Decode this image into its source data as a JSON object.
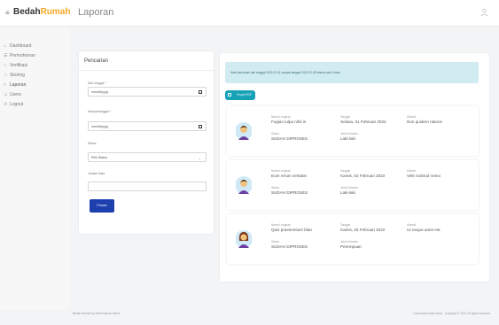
{
  "header": {
    "brand_prefix": "Bedah",
    "brand_accent": "Rumah",
    "page_title": "Laporan",
    "accent_color": "#f5a623"
  },
  "sidebar": {
    "items": [
      {
        "label": "Dashboard",
        "icon": "home-icon"
      },
      {
        "label": "Permohonan",
        "icon": "file-icon"
      },
      {
        "label": "Verifikasi",
        "icon": "check-icon"
      },
      {
        "label": "Skoring",
        "icon": "star-icon"
      },
      {
        "label": "Laporan",
        "icon": "report-icon"
      },
      {
        "label": "Users",
        "icon": "users-icon"
      },
      {
        "label": "Logout",
        "icon": "logout-icon"
      }
    ]
  },
  "search": {
    "title": "Pencarian",
    "from_label": "Dari tanggal *",
    "from_value": "mm/dd/yyyy",
    "to_label": "Sampai tanggal *",
    "to_value": "mm/dd/yyyy",
    "status_label": "Status",
    "status_value": "Pilih Status",
    "type_label": "Jumlah Data",
    "type_value": "",
    "process_label": "Proses",
    "process_color": "#1e40af"
  },
  "results": {
    "alert_text": "Hasil pencarian dari tanggal 2022-01-01 sampai tanggal 2022-02-28 ketemu ada 3 data",
    "export_label": "Export PDF",
    "labels": {
      "name": "Nama Lengkap",
      "date": "Tanggal",
      "address": "Alamat",
      "status": "Status",
      "gender": "Jenis Kelamin"
    },
    "items": [
      {
        "name": "Fugiat culpa nihil in",
        "date": "Selasa, 01 Februari 2022",
        "address": "Non quidem ratione",
        "status": "SUDAH DIPROSES",
        "gender": "Laki-laki",
        "avatar": "male-avatar-icon"
      },
      {
        "name": "Eum rerum veritatis",
        "date": "Kamis, 03 Februari 2022",
        "address": "Velit nostrud nemo",
        "status": "SUDAH DIPROSES",
        "gender": "Laki-laki",
        "avatar": "male-avatar-icon"
      },
      {
        "name": "Quis praesentium blan",
        "date": "Kamis, 03 Februari 2022",
        "address": "Ut neque amet est",
        "status": "SUDAH DIPROSES",
        "gender": "Perempuan",
        "avatar": "female-avatar-icon"
      }
    ]
  },
  "footer": {
    "left": "Bedah Rumah by Mitra Rumah Sehat",
    "right": "Universitas Mulia Nusa · Copyright © 2021 All rights reserved"
  }
}
